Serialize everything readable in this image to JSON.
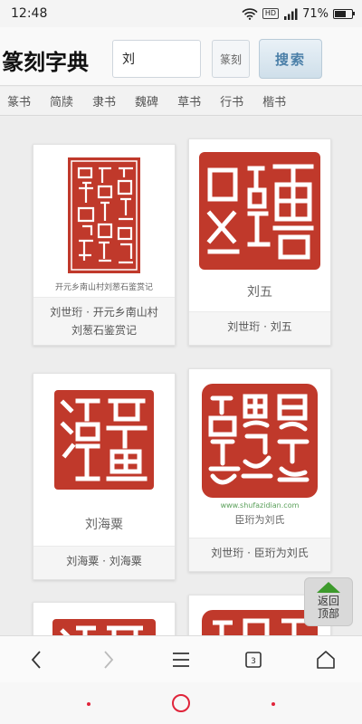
{
  "status_bar": {
    "time": "12:48",
    "hd": "HD",
    "battery_percent": "71%",
    "battery_level": 0.71
  },
  "header": {
    "logo": "篆刻字典",
    "search_value": "刘",
    "search_placeholder": "",
    "type_select": "篆刻",
    "search_button": "搜索"
  },
  "tabs": [
    "篆书",
    "简牍",
    "隶书",
    "魏碑",
    "草书",
    "行书",
    "楷书"
  ],
  "cards": [
    {
      "caption_line1": "刘世珩 · 开元乡南山村",
      "caption_line2": "刘葱石鉴赏记",
      "seal_subtitle": "开元乡南山村刘葱石鉴赏记"
    },
    {
      "caption_line1": "刘世珩 · 刘五",
      "seal_subtitle": "刘五"
    },
    {
      "caption_line1": "刘海粟 · 刘海粟",
      "seal_subtitle": "刘海粟"
    },
    {
      "caption_line1": "刘世珩 · 臣珩为刘氏",
      "seal_subtitle": "臣珩为刘氏",
      "watermark": "www.shufazidian.com"
    }
  ],
  "back_to_top": "返回顶部",
  "browser_nav": {
    "tab_count": "3"
  },
  "colors": {
    "seal_red": "#c0392b",
    "accent_blue": "#4a7fa8",
    "back_top_green": "#3d9a2c",
    "nav_red": "#e0243a"
  }
}
